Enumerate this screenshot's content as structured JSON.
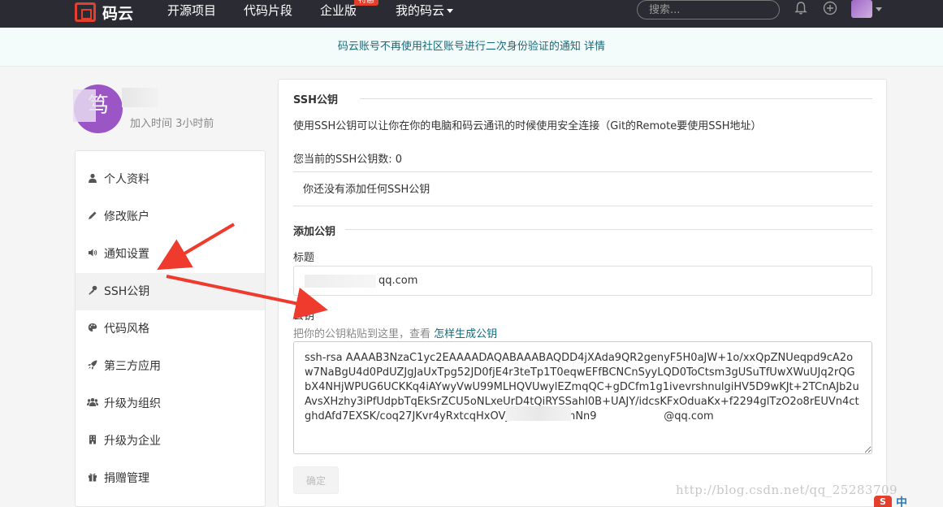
{
  "nav": {
    "logo_text": "码云",
    "items": [
      "开源项目",
      "代码片段",
      "企业版",
      "我的码云"
    ],
    "badge": "特惠",
    "search_placeholder": "搜索...",
    "icons": [
      "bell-icon",
      "plus-circle-icon"
    ]
  },
  "notice": "码云账号不再使用社区账号进行二次身份验证的通知 详情",
  "profile": {
    "avatar_letter": "笃",
    "join_time": "加入时间 3小时前"
  },
  "sidebar": {
    "items": [
      {
        "label": "个人资料",
        "icon": "user-icon"
      },
      {
        "label": "修改账户",
        "icon": "pencil-icon"
      },
      {
        "label": "通知设置",
        "icon": "speaker-icon"
      },
      {
        "label": "SSH公钥",
        "icon": "key-icon"
      },
      {
        "label": "代码风格",
        "icon": "palette-icon"
      },
      {
        "label": "第三方应用",
        "icon": "rocket-icon"
      },
      {
        "label": "升级为组织",
        "icon": "group-icon"
      },
      {
        "label": "升级为企业",
        "icon": "building-icon"
      },
      {
        "label": "捐赠管理",
        "icon": "gift-icon"
      }
    ]
  },
  "ssh": {
    "title": "SSH公钥",
    "description": "使用SSH公钥可以让你在你的电脑和码云通讯的时候使用安全连接（Git的Remote要使用SSH地址）",
    "count_label": "您当前的SSH公钥数: 0",
    "empty_text": "你还没有添加任何SSH公钥"
  },
  "add_key": {
    "title": "添加公钥",
    "field_title_label": "标题",
    "field_title_value": "qq.com",
    "field_key_label": "公钥",
    "hint_prefix": "把你的公钥粘贴到这里，查看",
    "hint_link": "怎样生成公钥",
    "key_value": "ssh-rsa AAAAB3NzaC1yc2EAAAADAQABAAABAQDD4jXAda9QR2genyF5H0aJW+1o/xxQpZNUeqpd9cA2ow7NaBgU4d0PdUZJgJaUxTpg52JD0fjE4r3teTp1T0eqwEFfBCNCnSyyLQD0ToCtsm3gUSuTfUwXWuUJq2rQGbX4NHjWPUG6UCKKq4iAYwyVwU99MLHQVUwylEZmqQC+gDCfm1g1ivevrshnulgiHV5D9wKJt+2TCnAJb2uAvsXHzhy3iPfUdpbTqEkSrZCU5oNLxeUrD4tQiRYSSahI0B+UAJY/idcsKFxOduaKx+f2294glTzO2o8rEUVn4ctghdAfd7EXSK/coq27JKvr4yRxtcqHxOVjA5+V1EbamNn9                    @qq.com",
    "submit_label": "确定"
  },
  "watermark": "http://blog.csdn.net/qq_25283709",
  "corner": {
    "logo": "S",
    "text": "中"
  }
}
